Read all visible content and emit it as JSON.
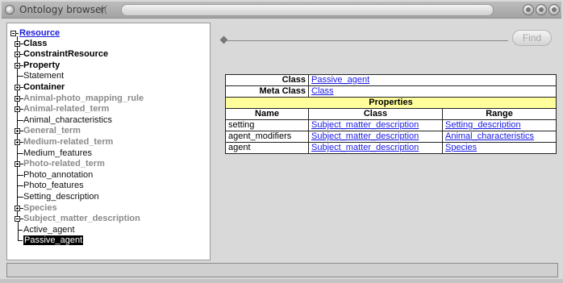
{
  "window": {
    "title": "Ontology browser",
    "title_decoration": "(("
  },
  "tree": {
    "root": "Resource",
    "items": [
      {
        "label": "Class",
        "style": "bold",
        "expandable": true
      },
      {
        "label": "ConstraintResource",
        "style": "bold",
        "expandable": true
      },
      {
        "label": "Property",
        "style": "bold",
        "expandable": true
      },
      {
        "label": "Statement",
        "style": "plain",
        "expandable": false
      },
      {
        "label": "Container",
        "style": "bold",
        "expandable": true
      },
      {
        "label": "Animal-photo_mapping_rule",
        "style": "grey",
        "expandable": true
      },
      {
        "label": "Animal-related_term",
        "style": "grey",
        "expandable": true
      },
      {
        "label": "Animal_characteristics",
        "style": "plain",
        "expandable": false
      },
      {
        "label": "General_term",
        "style": "grey",
        "expandable": true
      },
      {
        "label": "Medium-related_term",
        "style": "grey",
        "expandable": true
      },
      {
        "label": "Medium_features",
        "style": "plain",
        "expandable": false
      },
      {
        "label": "Photo-related_term",
        "style": "grey",
        "expandable": true
      },
      {
        "label": "Photo_annotation",
        "style": "plain",
        "expandable": false
      },
      {
        "label": "Photo_features",
        "style": "plain",
        "expandable": false
      },
      {
        "label": "Setting_description",
        "style": "plain",
        "expandable": false
      },
      {
        "label": "Species",
        "style": "grey",
        "expandable": true
      },
      {
        "label": "Subject_matter_description",
        "style": "grey",
        "expandable": true,
        "expanded": true
      }
    ],
    "children": [
      {
        "label": "Active_agent",
        "selected": false
      },
      {
        "label": "Passive_agent",
        "selected": true
      }
    ]
  },
  "toolbar": {
    "find_label": "Find"
  },
  "details": {
    "class_label": "Class",
    "class_value": "Passive_agent",
    "meta_class_label": "Meta Class",
    "meta_class_value": "Class",
    "properties_header": "Properties",
    "columns": [
      "Name",
      "Class",
      "Range"
    ],
    "rows": [
      {
        "name": "setting",
        "class": "Subject_matter_description",
        "range": "Setting_description"
      },
      {
        "name": "agent_modifiers",
        "class": "Subject_matter_description",
        "range": "Animal_characteristics"
      },
      {
        "name": "agent",
        "class": "Subject_matter_description",
        "range": "Species"
      }
    ]
  },
  "colors": {
    "link": "#1a1ae6",
    "properties_bg": "#fefe9c",
    "selection_bg": "#000000"
  }
}
